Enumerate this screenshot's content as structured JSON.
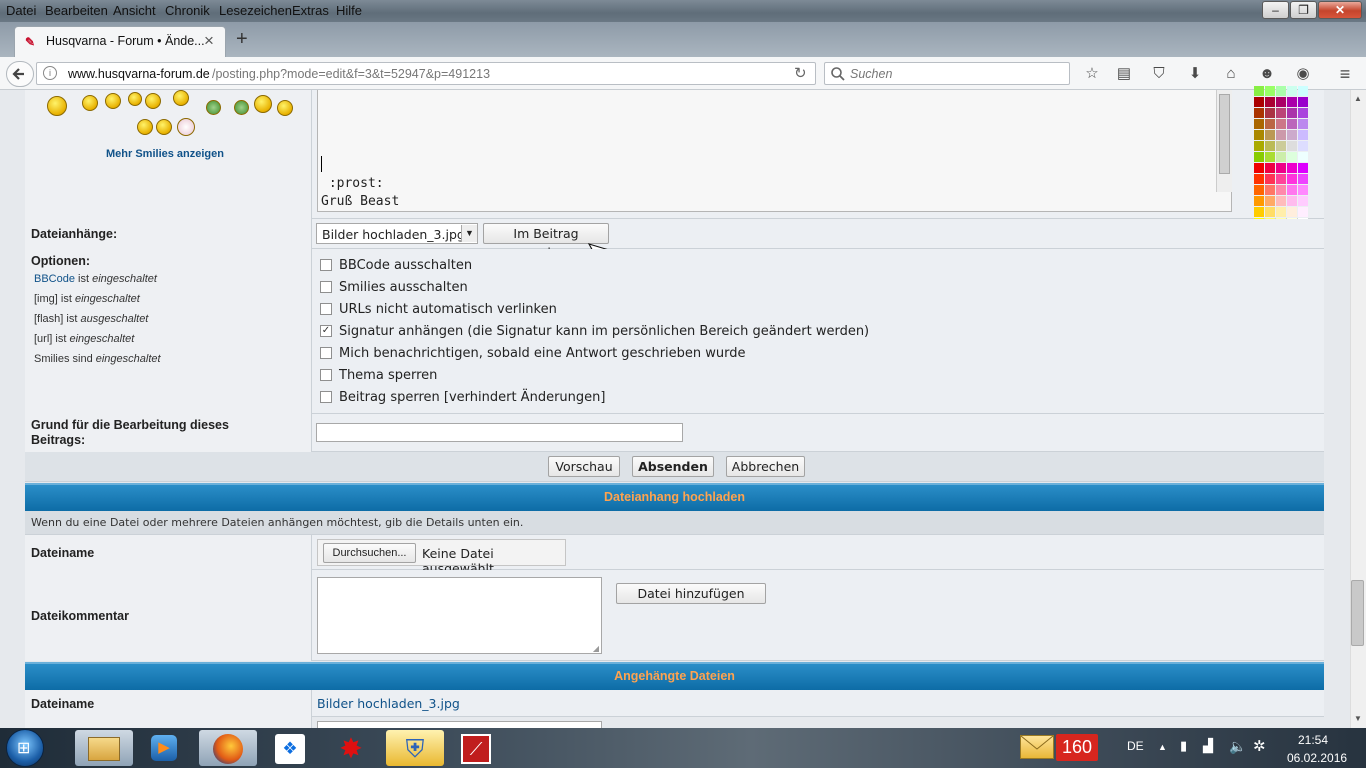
{
  "menubar": {
    "items": [
      "Datei",
      "Bearbeiten",
      "Ansicht",
      "Chronik",
      "Lesezeichen",
      "Extras",
      "Hilfe"
    ],
    "window_buttons": {
      "minimize": "–",
      "maximize": "❐",
      "close": "✕"
    }
  },
  "tabbar": {
    "active_tab_title": "Husqvarna - Forum • Ände...",
    "close_glyph": "×",
    "new_tab_glyph": "+"
  },
  "navbar": {
    "url_domain": "www.husqvarna-forum.de",
    "url_path": "/posting.php?mode=edit&f=3&t=52947&p=491213",
    "search_placeholder": "Suchen",
    "icons": [
      "star-icon",
      "reading-list-icon",
      "pocket-icon",
      "download-icon",
      "home-icon",
      "chat-icon",
      "readability-icon",
      "menu-icon"
    ]
  },
  "smilies": {
    "more_link": "Mehr Smilies anzeigen"
  },
  "editor": {
    "text_line1": " :prost:",
    "text_line2": "Gruß Beast"
  },
  "attachments_row": {
    "label": "Dateianhänge:",
    "select_value": "Bilder hochladen_3.jpg",
    "show_button": "Im Beitrag anzeigen"
  },
  "options": {
    "label": "Optionen:",
    "info": [
      {
        "prefix": "BBCode",
        "mid": " ist ",
        "state": "eingeschaltet"
      },
      {
        "prefix": "[img]",
        "mid": " ist ",
        "state": "eingeschaltet"
      },
      {
        "prefix": "[flash]",
        "mid": " ist ",
        "state": "ausgeschaltet"
      },
      {
        "prefix": "[url]",
        "mid": " ist ",
        "state": "eingeschaltet"
      },
      {
        "prefix": "Smilies",
        "mid": " sind ",
        "state": "eingeschaltet"
      }
    ],
    "checkboxes": [
      {
        "label": "BBCode ausschalten",
        "checked": false
      },
      {
        "label": "Smilies ausschalten",
        "checked": false
      },
      {
        "label": "URLs nicht automatisch verlinken",
        "checked": false
      },
      {
        "label": "Signatur anhängen (die Signatur kann im persönlichen Bereich geändert werden)",
        "checked": true
      },
      {
        "label": "Mich benachrichtigen, sobald eine Antwort geschrieben wurde",
        "checked": false
      },
      {
        "label": "Thema sperren",
        "checked": false
      },
      {
        "label": "Beitrag sperren [verhindert Änderungen]",
        "checked": false
      }
    ]
  },
  "edit_reason": {
    "label": "Grund für die Bearbeitung dieses Beitrags:",
    "value": ""
  },
  "actions": {
    "preview": "Vorschau",
    "submit": "Absenden",
    "cancel": "Abbrechen"
  },
  "upload_section": {
    "header": "Dateianhang hochladen",
    "hint": "Wenn du eine Datei oder mehrere Dateien anhängen möchtest, gib die Details unten ein.",
    "filename_label": "Dateiname",
    "browse_button": "Durchsuchen...",
    "no_file": "Keine Datei ausgewählt.",
    "comment_label": "Dateikommentar",
    "add_button": "Datei hinzufügen"
  },
  "attached_section": {
    "header": "Angehängte Dateien",
    "filename_label": "Dateiname",
    "filename_value": "Bilder hochladen_3.jpg"
  },
  "taskbar": {
    "mail_count": "160",
    "language": "DE",
    "time": "21:54",
    "date": "06.02.2016"
  },
  "colors": {
    "link": "#105289",
    "header_blue": "#0d6ca6",
    "header_text": "#ffa34f"
  }
}
